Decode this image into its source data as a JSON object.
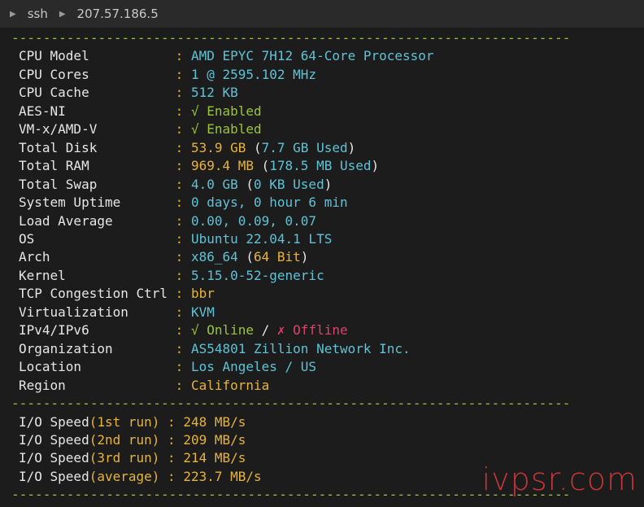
{
  "titlebar": {
    "items": [
      "ssh",
      "207.57.186.5"
    ]
  },
  "separator": "-----------------------------------------------------------------------",
  "info": [
    {
      "label": "CPU Model          ",
      "parts": [
        {
          "t": "AMD EPYC 7H12 64-Core Processor",
          "c": "cyan"
        }
      ]
    },
    {
      "label": "CPU Cores          ",
      "parts": [
        {
          "t": "1 @ 2595.102 MHz",
          "c": "cyan"
        }
      ]
    },
    {
      "label": "CPU Cache          ",
      "parts": [
        {
          "t": "512 KB",
          "c": "cyan"
        }
      ]
    },
    {
      "label": "AES-NI             ",
      "parts": [
        {
          "t": "√ Enabled",
          "c": "green"
        }
      ]
    },
    {
      "label": "VM-x/AMD-V         ",
      "parts": [
        {
          "t": "√ Enabled",
          "c": "green"
        }
      ]
    },
    {
      "label": "Total Disk         ",
      "parts": [
        {
          "t": "53.9 GB",
          "c": "yellow"
        },
        {
          "t": " (",
          "c": "white"
        },
        {
          "t": "7.7 GB Used",
          "c": "cyan"
        },
        {
          "t": ")",
          "c": "white"
        }
      ]
    },
    {
      "label": "Total RAM          ",
      "parts": [
        {
          "t": "969.4 MB",
          "c": "yellow"
        },
        {
          "t": " (",
          "c": "white"
        },
        {
          "t": "178.5 MB Used",
          "c": "cyan"
        },
        {
          "t": ")",
          "c": "white"
        }
      ]
    },
    {
      "label": "Total Swap         ",
      "parts": [
        {
          "t": "4.0 GB",
          "c": "cyan"
        },
        {
          "t": " (",
          "c": "white"
        },
        {
          "t": "0 KB Used",
          "c": "cyan"
        },
        {
          "t": ")",
          "c": "white"
        }
      ]
    },
    {
      "label": "System Uptime      ",
      "parts": [
        {
          "t": "0 days, 0 hour 6 min",
          "c": "cyan"
        }
      ]
    },
    {
      "label": "Load Average       ",
      "parts": [
        {
          "t": "0.00, 0.09, 0.07",
          "c": "cyan"
        }
      ]
    },
    {
      "label": "OS                 ",
      "parts": [
        {
          "t": "Ubuntu 22.04.1 LTS",
          "c": "cyan"
        }
      ]
    },
    {
      "label": "Arch               ",
      "parts": [
        {
          "t": "x86_64",
          "c": "cyan"
        },
        {
          "t": " (",
          "c": "white"
        },
        {
          "t": "64 Bit",
          "c": "yellow"
        },
        {
          "t": ")",
          "c": "white"
        }
      ]
    },
    {
      "label": "Kernel             ",
      "parts": [
        {
          "t": "5.15.0-52-generic",
          "c": "cyan"
        }
      ]
    },
    {
      "label": "TCP Congestion Ctrl",
      "parts": [
        {
          "t": "bbr",
          "c": "yellow"
        }
      ]
    },
    {
      "label": "Virtualization     ",
      "parts": [
        {
          "t": "KVM",
          "c": "cyan"
        }
      ]
    },
    {
      "label": "IPv4/IPv6          ",
      "parts": [
        {
          "t": "√ Online",
          "c": "green"
        },
        {
          "t": " / ",
          "c": "white"
        },
        {
          "t": "✗ Offline",
          "c": "red"
        }
      ]
    },
    {
      "label": "Organization       ",
      "parts": [
        {
          "t": "AS54801 Zillion Network Inc.",
          "c": "cyan"
        }
      ]
    },
    {
      "label": "Location           ",
      "parts": [
        {
          "t": "Los Angeles / US",
          "c": "cyan"
        }
      ]
    },
    {
      "label": "Region             ",
      "parts": [
        {
          "t": "California",
          "c": "yellow"
        }
      ]
    }
  ],
  "io": [
    {
      "label": "I/O Speed",
      "paren": "(1st run)",
      "value": "248 MB/s"
    },
    {
      "label": "I/O Speed",
      "paren": "(2nd run)",
      "value": "209 MB/s"
    },
    {
      "label": "I/O Speed",
      "paren": "(3rd run)",
      "value": "214 MB/s"
    },
    {
      "label": "I/O Speed",
      "paren": "(average)",
      "value": "223.7 MB/s"
    }
  ],
  "watermark": "ivpsr.com"
}
